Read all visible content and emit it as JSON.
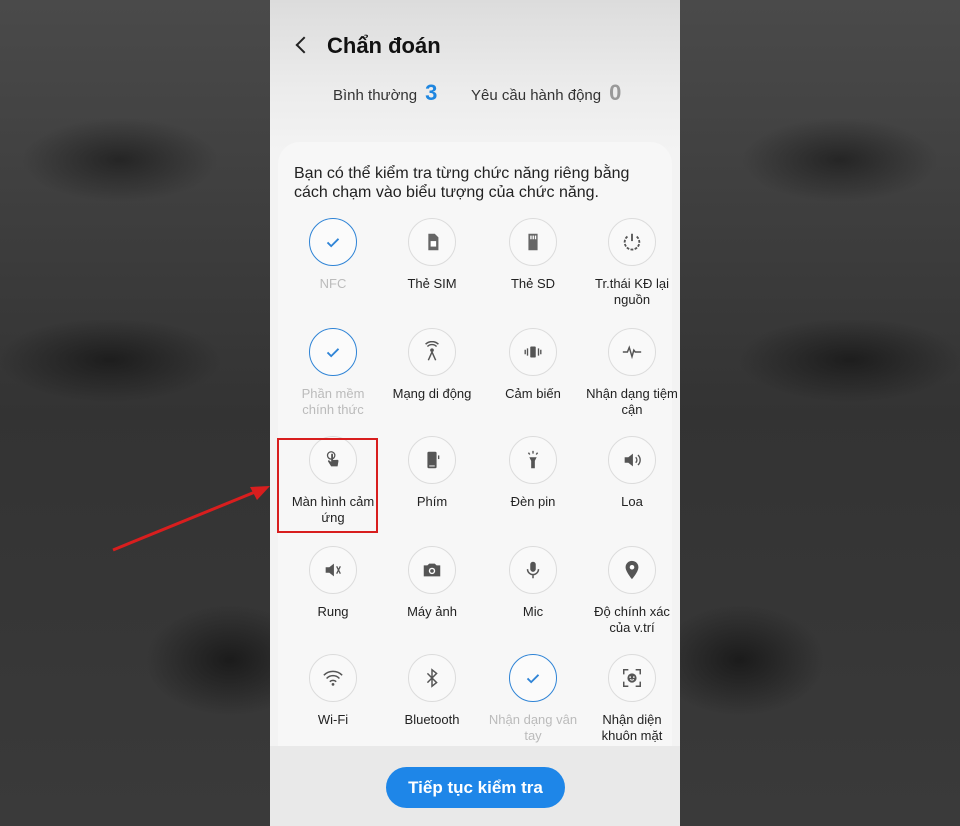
{
  "header": {
    "title": "Chẩn đoán",
    "normal_label": "Bình thường",
    "normal_count": "3",
    "action_label": "Yêu cầu hành động",
    "action_count": "0"
  },
  "card": {
    "description": "Bạn có thể kiểm tra từng chức năng riêng bằng cách chạm vào biểu tượng của chức năng."
  },
  "tests": [
    {
      "label": "NFC",
      "icon": "check-icon",
      "checked": true
    },
    {
      "label": "Thẻ SIM",
      "icon": "sim-card-icon",
      "checked": false
    },
    {
      "label": "Thẻ SD",
      "icon": "sd-card-icon",
      "checked": false
    },
    {
      "label": "Tr.thái KĐ lại nguồn",
      "icon": "power-restart-icon",
      "checked": false
    },
    {
      "label": "Phần mềm chính thức",
      "icon": "check-icon",
      "checked": true
    },
    {
      "label": "Mạng di động",
      "icon": "antenna-icon",
      "checked": false
    },
    {
      "label": "Cảm biến",
      "icon": "sensor-icon",
      "checked": false
    },
    {
      "label": "Nhận dạng tiệm cận",
      "icon": "proximity-icon",
      "checked": false
    },
    {
      "label": "Màn hình cảm ứng",
      "icon": "touch-icon",
      "checked": false
    },
    {
      "label": "Phím",
      "icon": "phone-keys-icon",
      "checked": false
    },
    {
      "label": "Đèn pin",
      "icon": "flashlight-icon",
      "checked": false
    },
    {
      "label": "Loa",
      "icon": "speaker-icon",
      "checked": false
    },
    {
      "label": "Rung",
      "icon": "vibrate-icon",
      "checked": false
    },
    {
      "label": "Máy ảnh",
      "icon": "camera-icon",
      "checked": false
    },
    {
      "label": "Mic",
      "icon": "microphone-icon",
      "checked": false
    },
    {
      "label": "Độ chính xác của v.trí",
      "icon": "location-pin-icon",
      "checked": false
    },
    {
      "label": "Wi-Fi",
      "icon": "wifi-icon",
      "checked": false
    },
    {
      "label": "Bluetooth",
      "icon": "bluetooth-icon",
      "checked": false
    },
    {
      "label": "Nhận dạng vân tay",
      "icon": "check-icon",
      "checked": true
    },
    {
      "label": "Nhận diện khuôn mặt",
      "icon": "face-recognition-icon",
      "checked": false
    }
  ],
  "footer": {
    "continue_label": "Tiếp tục kiểm tra"
  },
  "colors": {
    "accent": "#1e86e8",
    "highlight": "#d81e1e"
  }
}
